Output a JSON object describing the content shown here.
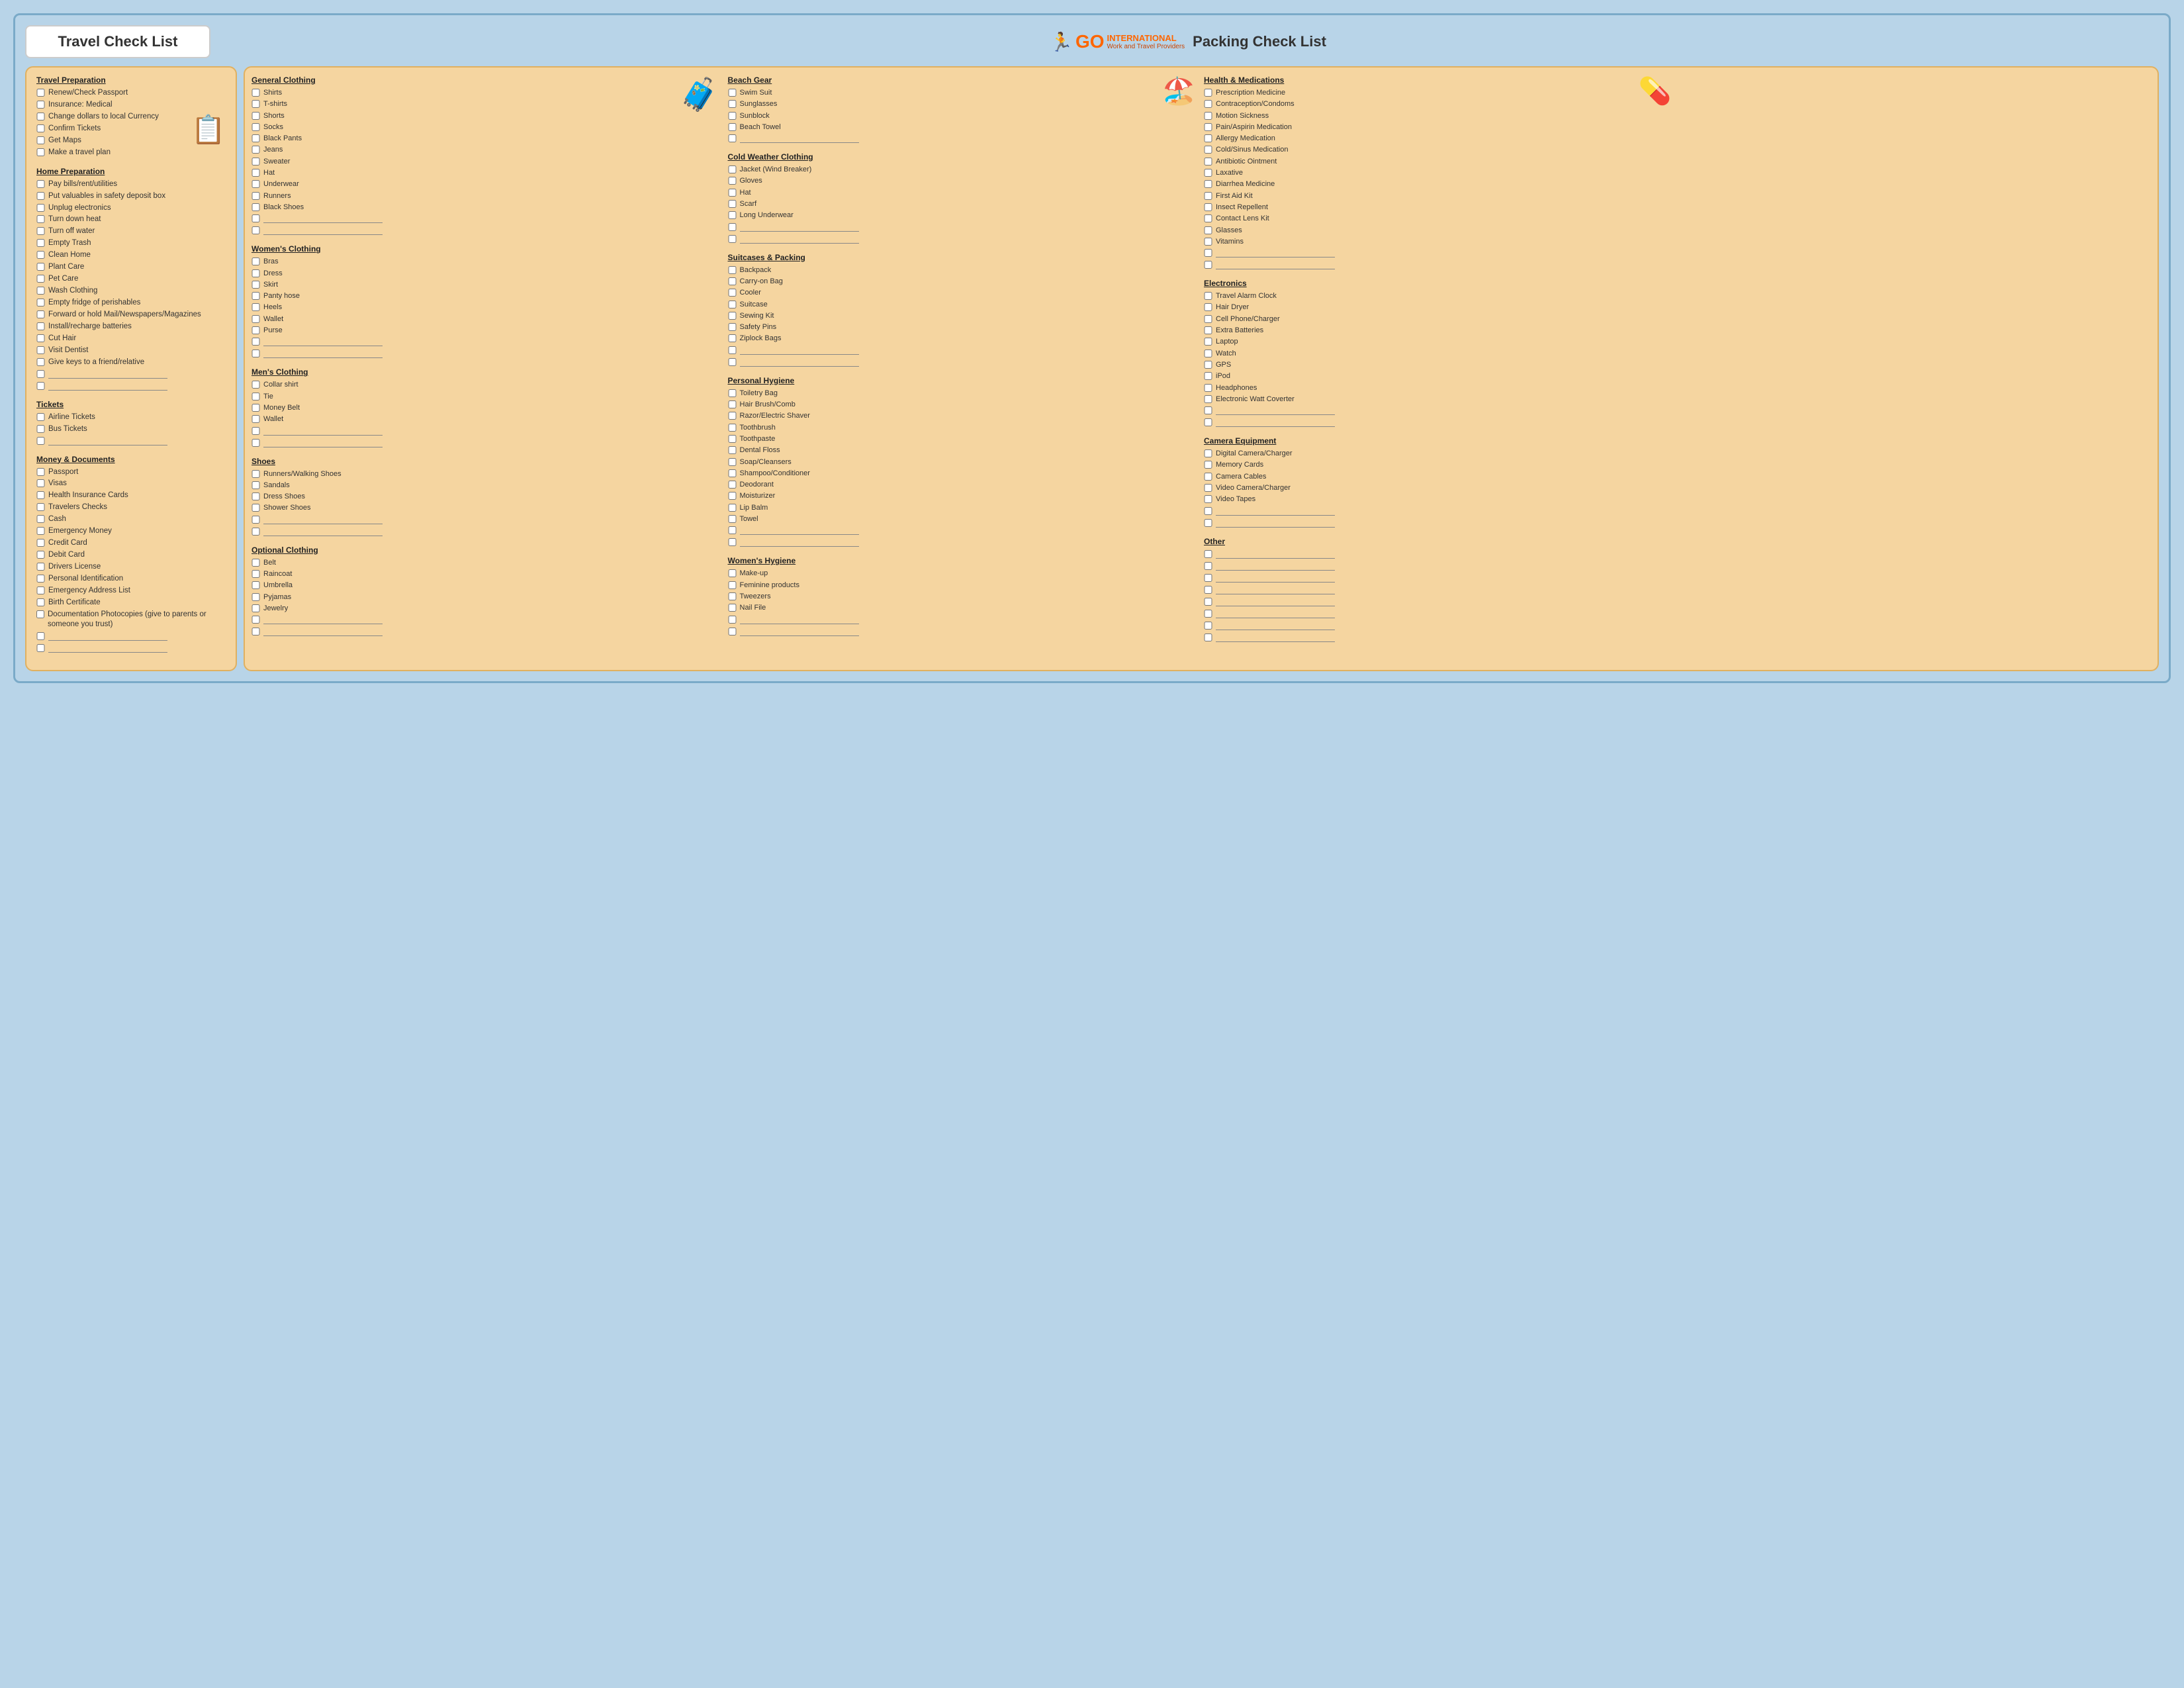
{
  "header": {
    "travel_title": "Travel Check List",
    "packing_title": "Packing Check List",
    "logo_go": "GO",
    "logo_international": "INTERNATIONAL",
    "logo_sub": "Work and Travel Providers"
  },
  "left": {
    "sections": [
      {
        "id": "travel-preparation",
        "title": "Travel Preparation",
        "items": [
          "Renew/Check Passport",
          "Insurance: Medical",
          "Change dollars to local Currency",
          "Confirm Tickets",
          "Get Maps",
          "Make a travel plan"
        ],
        "blanks": 0
      },
      {
        "id": "home-preparation",
        "title": "Home Preparation",
        "items": [
          "Pay bills/rent/utilities",
          "Put valuables in safety deposit box",
          "Unplug electronics",
          "Turn down heat",
          "Turn off water",
          "Empty Trash",
          "Clean Home",
          "Plant Care",
          "Pet Care",
          "Wash Clothing",
          "Empty fridge of perishables",
          "Forward or hold Mail/Newspapers/Magazines",
          "Install/recharge batteries",
          "Cut Hair",
          "Visit Dentist",
          "Give keys to a friend/relative"
        ],
        "blanks": 2
      },
      {
        "id": "tickets",
        "title": "Tickets",
        "items": [
          "Airline Tickets",
          "Bus Tickets"
        ],
        "blanks": 1
      },
      {
        "id": "money-documents",
        "title": "Money & Documents",
        "items": [
          "Passport",
          "Visas",
          "Health Insurance Cards",
          "Travelers Checks",
          "Cash",
          "Emergency Money",
          "Credit Card",
          "Debit Card",
          "Drivers License",
          "Personal Identification",
          "Emergency Address List",
          "Birth Certificate",
          "Documentation Photocopies (give to parents or someone you trust)"
        ],
        "blanks": 2
      }
    ]
  },
  "right": {
    "col1": {
      "sections": [
        {
          "id": "general-clothing",
          "title": "General Clothing",
          "items": [
            "Shirts",
            "T-shirts",
            "Shorts",
            "Socks",
            "Black Pants",
            "Jeans",
            "Sweater",
            "Hat",
            "Underwear",
            "Runners",
            "Black Shoes"
          ],
          "blanks": 2
        },
        {
          "id": "womens-clothing",
          "title": "Women's Clothing",
          "items": [
            "Bras",
            "Dress",
            "Skirt",
            "Panty hose",
            "Heels",
            "Wallet",
            "Purse"
          ],
          "blanks": 2
        },
        {
          "id": "mens-clothing",
          "title": "Men's Clothing",
          "items": [
            "Collar shirt",
            "Tie",
            "Money Belt",
            "Wallet"
          ],
          "blanks": 2
        },
        {
          "id": "shoes",
          "title": "Shoes",
          "items": [
            "Runners/Walking Shoes",
            "Sandals",
            "Dress Shoes",
            "Shower Shoes"
          ],
          "blanks": 2
        },
        {
          "id": "optional-clothing",
          "title": "Optional Clothing",
          "items": [
            "Belt",
            "Raincoat",
            "Umbrella",
            "Pyjamas",
            "Jewelry"
          ],
          "blanks": 2
        }
      ]
    },
    "col2": {
      "sections": [
        {
          "id": "beach-gear",
          "title": "Beach Gear",
          "items": [
            "Swim Suit",
            "Sunglasses",
            "Sunblock",
            "Beach Towel"
          ],
          "blanks": 1
        },
        {
          "id": "cold-weather-clothing",
          "title": "Cold Weather Clothing",
          "items": [
            "Jacket (Wind Breaker)",
            "Gloves",
            "Hat",
            "Scarf",
            "Long Underwear"
          ],
          "blanks": 2
        },
        {
          "id": "suitcases-packing",
          "title": "Suitcases & Packing",
          "items": [
            "Backpack",
            "Carry-on Bag",
            "Cooler",
            "Suitcase",
            "Sewing Kit",
            "Safety Pins",
            "Ziplock Bags"
          ],
          "blanks": 2
        },
        {
          "id": "personal-hygiene",
          "title": "Personal Hygiene",
          "items": [
            "Toiletry Bag",
            "Hair Brush/Comb",
            "Razor/Electric Shaver",
            "Toothbrush",
            "Toothpaste",
            "Dental Floss",
            "Soap/Cleansers",
            "Shampoo/Conditioner",
            "Deodorant",
            "Moisturizer",
            "Lip Balm",
            "Towel"
          ],
          "blanks": 2
        },
        {
          "id": "womens-hygiene",
          "title": "Women's Hygiene",
          "items": [
            "Make-up",
            "Feminine products",
            "Tweezers",
            "Nail File"
          ],
          "blanks": 2
        }
      ]
    },
    "col3": {
      "sections": [
        {
          "id": "health-medications",
          "title": "Health & Medications",
          "items": [
            "Prescription Medicine",
            "Contraception/Condoms",
            "Motion Sickness",
            "Pain/Aspirin Medication",
            "Allergy Medication",
            "Cold/Sinus Medication",
            "Antibiotic Ointment",
            "Laxative",
            "Diarrhea Medicine",
            "First Aid Kit",
            "Insect Repellent",
            "Contact Lens Kit",
            "Glasses",
            "Vitamins"
          ],
          "blanks": 2
        },
        {
          "id": "electronics",
          "title": "Electronics",
          "items": [
            "Travel Alarm Clock",
            "Hair Dryer",
            "Cell Phone/Charger",
            "Extra Batteries",
            "Laptop",
            "Watch",
            "GPS",
            "iPod",
            "Headphones",
            "Electronic Watt Coverter"
          ],
          "blanks": 2
        },
        {
          "id": "camera-equipment",
          "title": "Camera Equipment",
          "items": [
            "Digital Camera/Charger",
            "Memory Cards",
            "Camera Cables",
            "Video Camera/Charger",
            "Video Tapes"
          ],
          "blanks": 2
        },
        {
          "id": "other",
          "title": "Other",
          "items": [],
          "blanks": 8
        }
      ]
    }
  }
}
